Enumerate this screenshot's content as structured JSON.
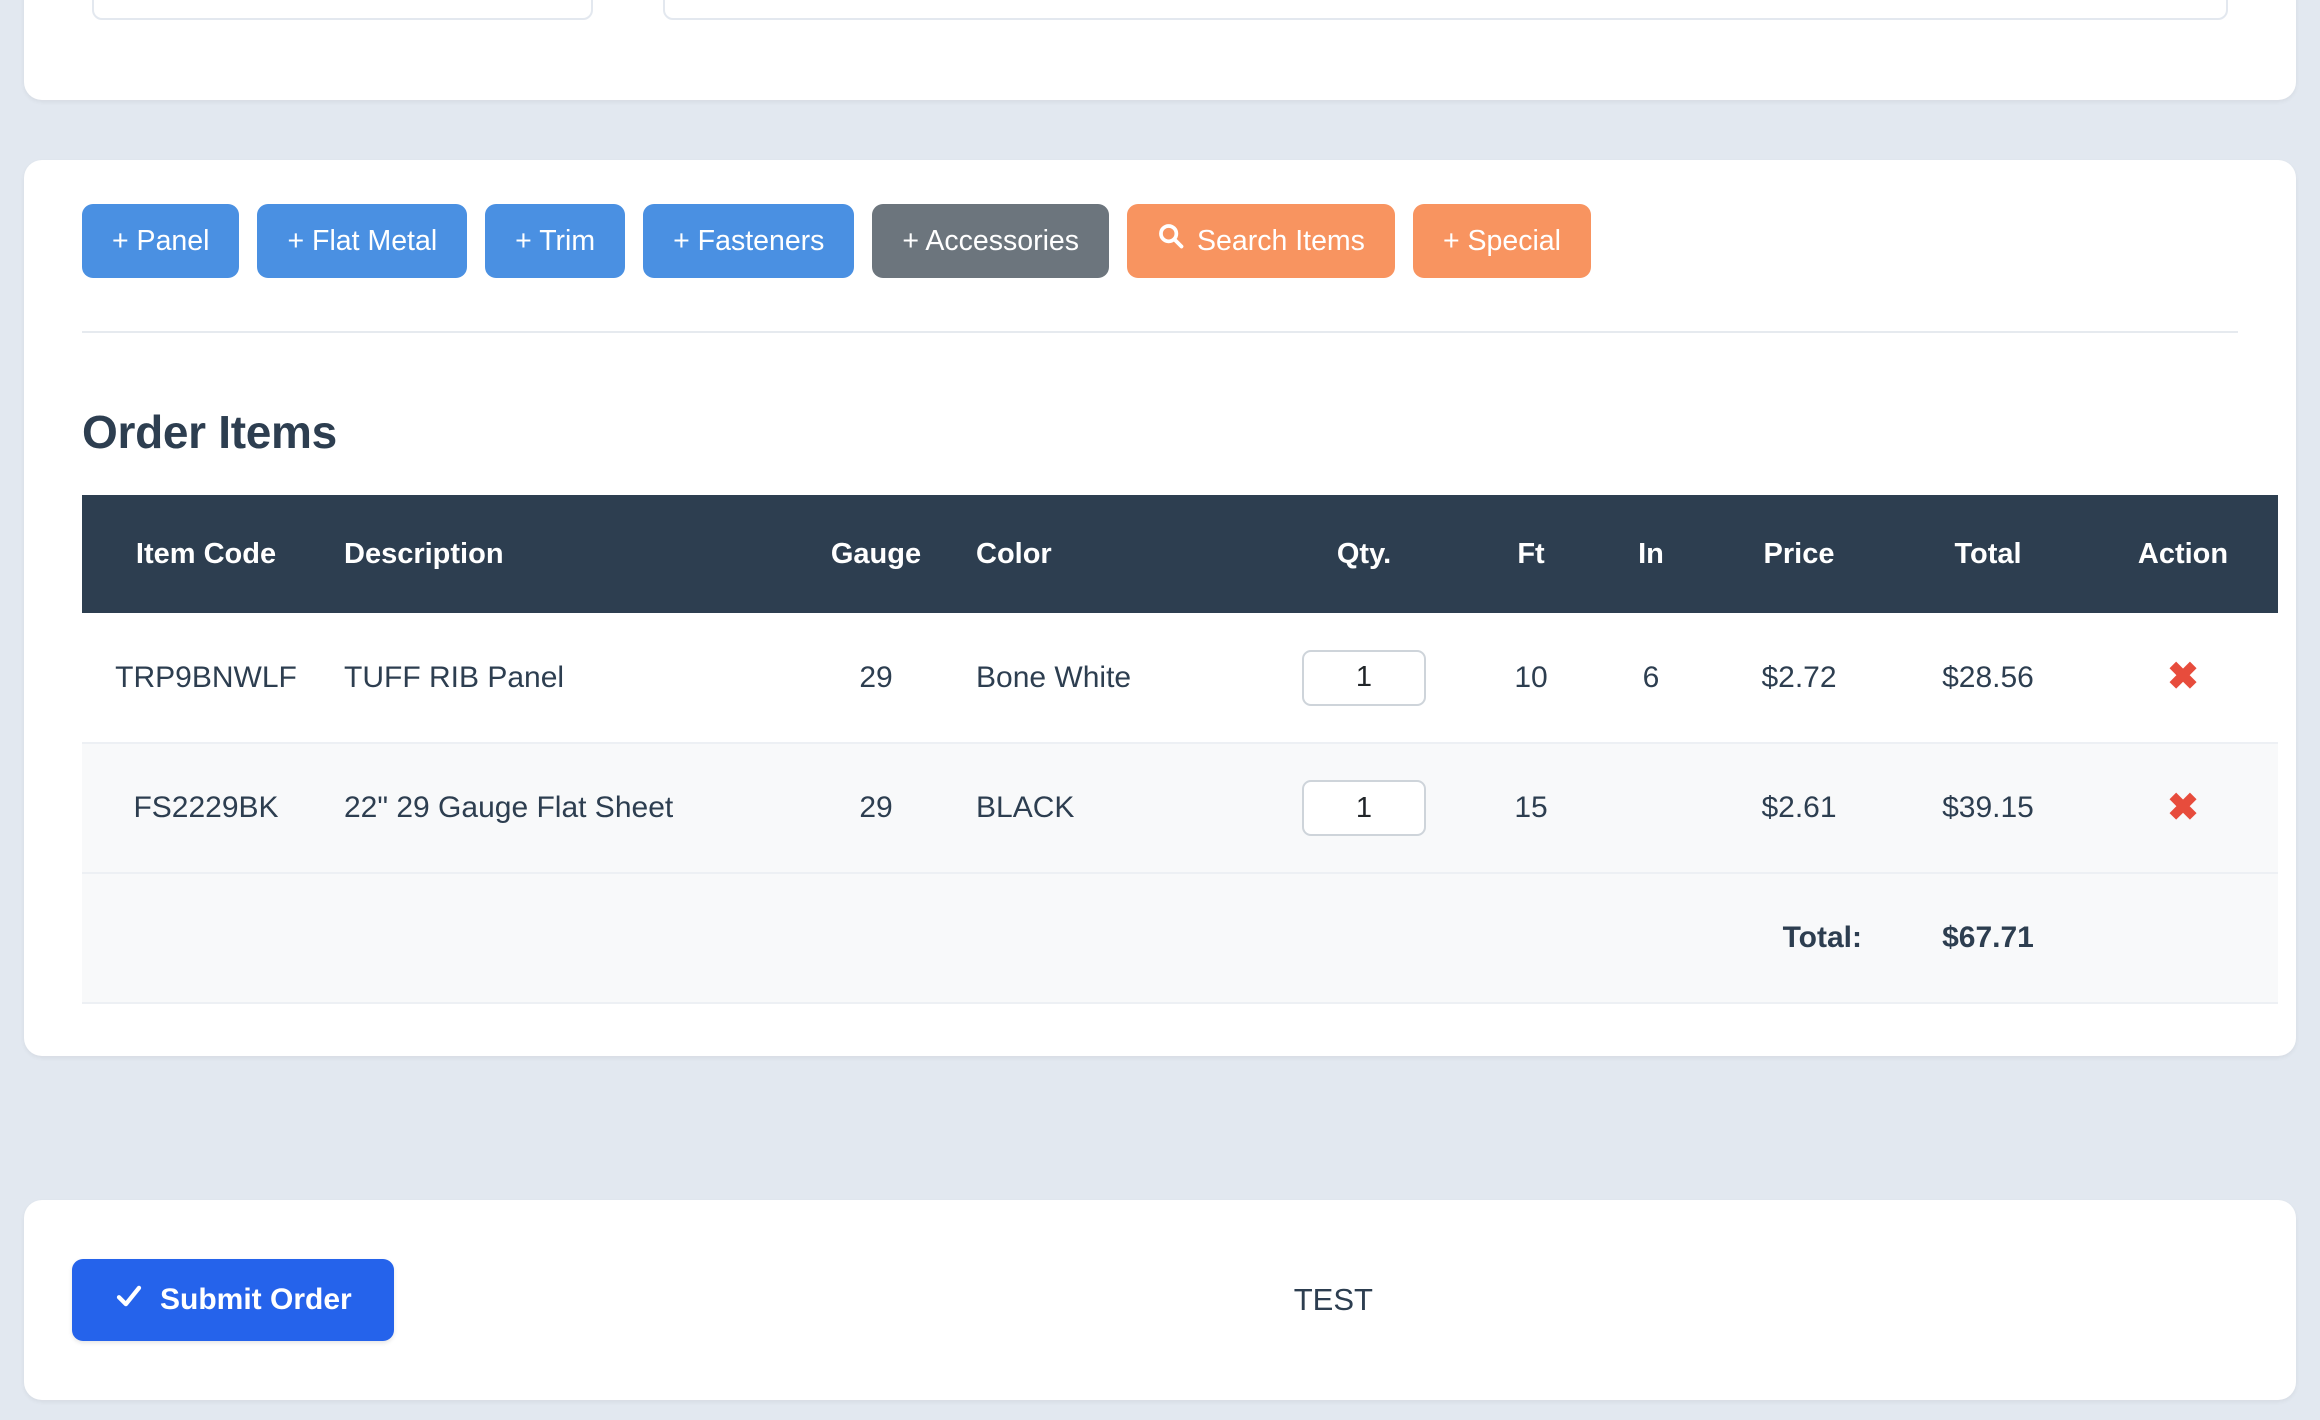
{
  "top_panel": {
    "fields": [
      {
        "name": "field-left",
        "value": "",
        "placeholder": ""
      },
      {
        "name": "field-right",
        "value": "",
        "placeholder": ""
      }
    ]
  },
  "toolbar": {
    "buttons": [
      {
        "label": "+ Panel",
        "style": "blue",
        "icon": null
      },
      {
        "label": "+ Flat Metal",
        "style": "blue",
        "icon": null
      },
      {
        "label": "+ Trim",
        "style": "blue",
        "icon": null
      },
      {
        "label": "+ Fasteners",
        "style": "blue",
        "icon": null
      },
      {
        "label": "+ Accessories",
        "style": "gray",
        "icon": null
      },
      {
        "label": "Search Items",
        "style": "orange",
        "icon": "search-icon"
      },
      {
        "label": "+ Special",
        "style": "orange",
        "icon": null
      }
    ]
  },
  "order_items": {
    "title": "Order Items",
    "columns": [
      "Item Code",
      "Description",
      "Gauge",
      "Color",
      "Qty.",
      "Ft",
      "In",
      "Price",
      "Total",
      "Action"
    ],
    "rows": [
      {
        "item_code": "TRP9BNWLF",
        "description": "TUFF RIB Panel",
        "gauge": "29",
        "color": "Bone White",
        "qty": "1",
        "ft": "10",
        "in": "6",
        "price": "$2.72",
        "total": "$28.56",
        "action_icon": "remove-icon"
      },
      {
        "item_code": "FS2229BK",
        "description": "22\" 29 Gauge Flat Sheet",
        "gauge": "29",
        "color": "BLACK",
        "qty": "1",
        "ft": "15",
        "in": "",
        "price": "$2.61",
        "total": "$39.15",
        "action_icon": "remove-icon"
      }
    ],
    "total_label": "Total:",
    "total_value": "$67.71"
  },
  "footer": {
    "submit_label": "Submit Order",
    "submit_icon": "check-icon",
    "note": "TEST"
  },
  "colors": {
    "page_background": "#e2e8f0",
    "card_background": "#ffffff",
    "primary_blue": "#4a90e2",
    "submit_blue": "#2563eb",
    "gray_button": "#6c757d",
    "orange_button": "#f89460",
    "table_header": "#2d3e50",
    "row_alt": "#f8f9fa",
    "delete_red": "#e74c3c",
    "text_dark": "#2d3e50"
  }
}
